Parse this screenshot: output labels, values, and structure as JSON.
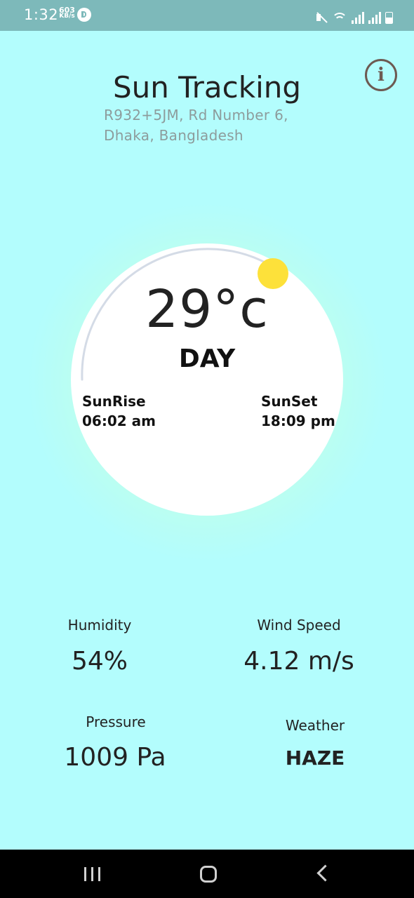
{
  "status_bar": {
    "time": "1:32",
    "speed_value": "603",
    "speed_unit": "KB/s"
  },
  "header": {
    "title": "Sun Tracking",
    "address_line1": "R932+5JM, Rd Number 6,",
    "address_line2": "Dhaka, Bangladesh",
    "info_icon_text": "i"
  },
  "sun": {
    "temperature": "29°c",
    "phase": "DAY",
    "sunrise_label": "SunRise",
    "sunrise_time": "06:02 am",
    "sunset_label": "SunSet",
    "sunset_time": "18:09 pm"
  },
  "stats": {
    "humidity_label": "Humidity",
    "humidity_value": "54%",
    "wind_label": "Wind Speed",
    "wind_value": "4.12 m/s",
    "pressure_label": "Pressure",
    "pressure_value": "1009 Pa",
    "weather_label": "Weather",
    "weather_value": "HAZE"
  },
  "colors": {
    "background": "#b3fdfd",
    "status_bar": "#7db9ba",
    "sun": "#fde13a",
    "info_icon": "#6d5a52"
  },
  "icons": {
    "info": "info-circle-icon",
    "sun": "sun-icon",
    "nav_recent": "recent-apps-icon",
    "nav_home": "home-icon",
    "nav_back": "back-icon"
  }
}
